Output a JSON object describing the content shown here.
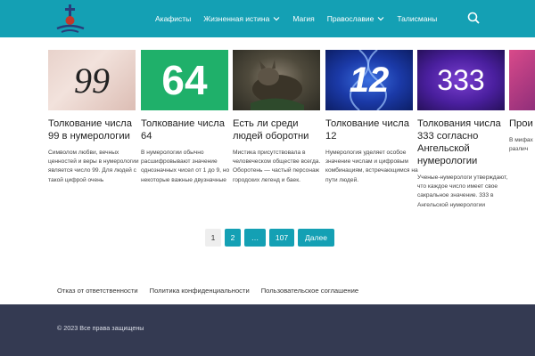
{
  "header": {
    "nav": [
      {
        "label": "Акафисты",
        "dropdown": false
      },
      {
        "label": "Жизненная истина",
        "dropdown": true
      },
      {
        "label": "Магия",
        "dropdown": false
      },
      {
        "label": "Православие",
        "dropdown": true
      },
      {
        "label": "Талисманы",
        "dropdown": false
      }
    ],
    "search_icon": "search-icon",
    "logo_icon": "cross-church-logo"
  },
  "cards": [
    {
      "thumb_text": "99",
      "title": "Толкование числа 99 в нумерологии",
      "excerpt": "Символом любви, вечных ценностей и веры в нумерологии является число 99. Для людей с такой цифрой очень"
    },
    {
      "thumb_text": "64",
      "title": "Толкование числа 64",
      "excerpt": "В нумерологии обычно расшифровывают значение однозначных чисел от 1 до 9, но некоторые важные двузначные"
    },
    {
      "thumb_text": "",
      "title": "Есть ли среди людей оборотни",
      "excerpt": "Мистика присутствовала в человеческом обществе всегда. Оборотень — частый персонаж городских легенд и баек."
    },
    {
      "thumb_text": "12",
      "title": "Толкование числа 12",
      "excerpt": "Нумерология уделяет особое значение числам и цифровым комбинациям, встречающимся на пути людей."
    },
    {
      "thumb_text": "333",
      "title": "Толкования числа 333 согласно Ангельской нумерологии",
      "excerpt": "Ученые-нумерологи утверждают, что каждое число имеет свое сакральное значение. 333 в Ангельской нумерологии"
    },
    {
      "thumb_text": "",
      "title": "Прои разно пикси",
      "excerpt": "В мифах времён встреті необыч различ"
    }
  ],
  "pagination": {
    "current": "1",
    "pages": [
      "2",
      "…",
      "107"
    ],
    "next": "Далее"
  },
  "footer": {
    "links": [
      "Отказ от ответственности",
      "Политика конфиденциальности",
      "Пользовательское соглашение"
    ],
    "copyright": "© 2023 Все права защищены"
  },
  "colors": {
    "header": "#14a0b4",
    "bottom": "#343a52"
  }
}
